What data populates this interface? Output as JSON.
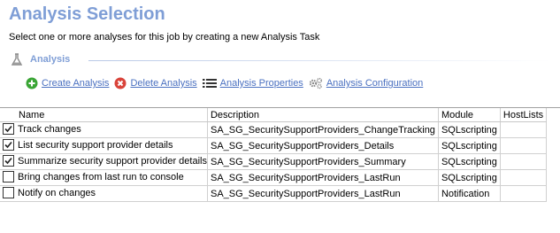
{
  "header": {
    "title": "Analysis Selection",
    "subtitle": "Select one or more analyses for this job by creating a new Analysis Task"
  },
  "section": {
    "label": "Analysis"
  },
  "toolbar": {
    "create_label": "Create Analysis",
    "delete_label": "Delete Analysis",
    "properties_label": "Analysis Properties",
    "configuration_label": "Analysis Configuration"
  },
  "table": {
    "columns": [
      "Name",
      "Description",
      "Module",
      "HostLists"
    ],
    "rows": [
      {
        "checked": true,
        "name": "Track changes",
        "description": "SA_SG_SecuritySupportProviders_ChangeTracking",
        "module": "SQLscripting",
        "hostlists": ""
      },
      {
        "checked": true,
        "name": "List security support provider details",
        "description": "SA_SG_SecuritySupportProviders_Details",
        "module": "SQLscripting",
        "hostlists": ""
      },
      {
        "checked": true,
        "name": "Summarize security support provider details",
        "description": "SA_SG_SecuritySupportProviders_Summary",
        "module": "SQLscripting",
        "hostlists": ""
      },
      {
        "checked": false,
        "name": "Bring changes from last run to console",
        "description": "SA_SG_SecuritySupportProviders_LastRun",
        "module": "SQLscripting",
        "hostlists": ""
      },
      {
        "checked": false,
        "name": "Notify on changes",
        "description": "SA_SG_SecuritySupportProviders_LastRun",
        "module": "Notification",
        "hostlists": ""
      }
    ]
  },
  "colors": {
    "title": "#7f9ed6",
    "link": "#4a70c0",
    "create_icon": "#3aa535",
    "delete_icon": "#d9433a"
  },
  "icons": {
    "section": "flask-icon",
    "create": "plus-circle-icon",
    "delete": "delete-circle-icon",
    "properties": "list-icon",
    "configuration": "gears-icon"
  }
}
